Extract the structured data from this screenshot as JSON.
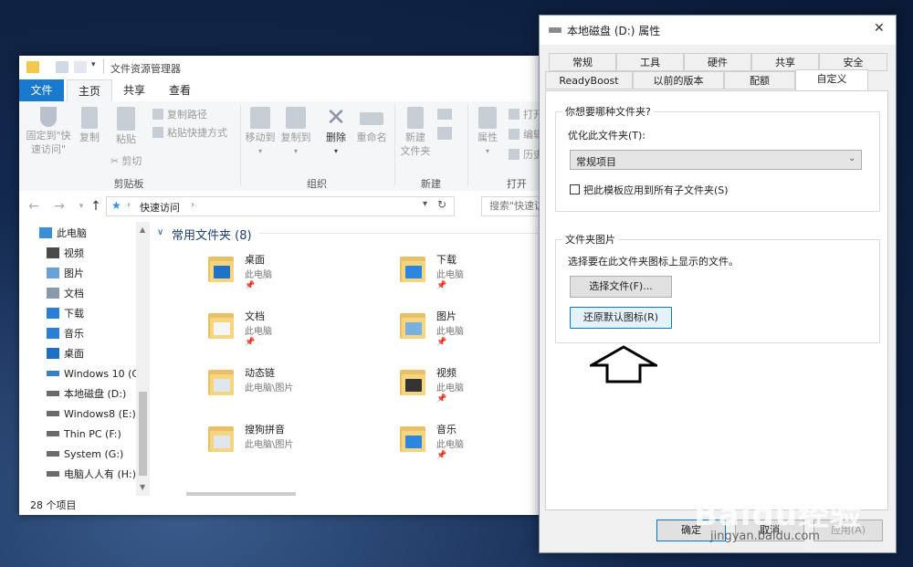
{
  "explorer": {
    "title": "文件资源管理器",
    "tabs": {
      "file": "文件",
      "home": "主页",
      "share": "共享",
      "view": "查看"
    },
    "ribbon": {
      "pin_quick_access_l1": "固定到\"快",
      "pin_quick_access_l2": "速访问\"",
      "copy": "复制",
      "paste": "粘贴",
      "copy_path": "复制路径",
      "paste_shortcut": "粘贴快捷方式",
      "cut": "剪切",
      "group_clipboard": "剪贴板",
      "move_to": "移动到",
      "copy_to": "复制到",
      "delete": "删除",
      "rename": "重命名",
      "group_organize": "组织",
      "new_folder_l1": "新建",
      "new_folder_l2": "文件夹",
      "group_new": "新建",
      "properties": "属性",
      "open": "打开",
      "edit": "编辑",
      "history": "历史",
      "group_open": "打开"
    },
    "address": {
      "path": "快速访问",
      "search_placeholder": "搜索\"快速访"
    },
    "nav_items": [
      {
        "label": "此电脑",
        "icon": "pc-icon"
      },
      {
        "label": "视频",
        "icon": "video-icon"
      },
      {
        "label": "图片",
        "icon": "pictures-icon"
      },
      {
        "label": "文档",
        "icon": "documents-icon"
      },
      {
        "label": "下载",
        "icon": "download-icon"
      },
      {
        "label": "音乐",
        "icon": "music-icon"
      },
      {
        "label": "桌面",
        "icon": "desktop-icon"
      },
      {
        "label": "Windows 10 (C",
        "icon": "drive-c-icon"
      },
      {
        "label": "本地磁盘 (D:)",
        "icon": "drive-icon"
      },
      {
        "label": "Windows8 (E:)",
        "icon": "drive-icon"
      },
      {
        "label": "Thin PC (F:)",
        "icon": "drive-icon"
      },
      {
        "label": "System (G:)",
        "icon": "drive-icon"
      },
      {
        "label": "电脑人人有 (H:)",
        "icon": "drive-icon"
      }
    ],
    "section_title": "常用文件夹 (8)",
    "folders": [
      {
        "name": "桌面",
        "loc": "此电脑",
        "icon": "desktop-folder-icon"
      },
      {
        "name": "下载",
        "loc": "此电脑",
        "icon": "download-folder-icon"
      },
      {
        "name": "文档",
        "loc": "此电脑",
        "icon": "documents-folder-icon"
      },
      {
        "name": "图片",
        "loc": "此电脑",
        "icon": "pictures-folder-icon"
      },
      {
        "name": "动态链",
        "loc": "此电脑\\图片",
        "icon": "folder-icon"
      },
      {
        "name": "视频",
        "loc": "此电脑",
        "icon": "video-folder-icon"
      },
      {
        "name": "搜狗拼音",
        "loc": "此电脑\\图片",
        "icon": "folder-icon"
      },
      {
        "name": "音乐",
        "loc": "此电脑",
        "icon": "music-folder-icon"
      }
    ],
    "status": "28 个项目"
  },
  "dialog": {
    "title": "本地磁盘 (D:) 属性",
    "tabs_row1": [
      "常规",
      "工具",
      "硬件",
      "共享",
      "安全"
    ],
    "tabs_row2": [
      "ReadyBoost",
      "以前的版本",
      "配额",
      "自定义"
    ],
    "group1_title": "你想要哪种文件夹?",
    "optimize_label": "优化此文件夹(T):",
    "optimize_value": "常规项目",
    "apply_subfolders": "把此模板应用到所有子文件夹(S)",
    "group2_title": "文件夹图片",
    "group2_desc": "选择要在此文件夹图标上显示的文件。",
    "choose_file": "选择文件(F)...",
    "restore_default": "还原默认图标(R)",
    "ok": "确定",
    "cancel": "取消",
    "apply": "应用(A)"
  },
  "watermark": {
    "brand": "Baidu经验",
    "url": "jingyan.baidu.com"
  }
}
